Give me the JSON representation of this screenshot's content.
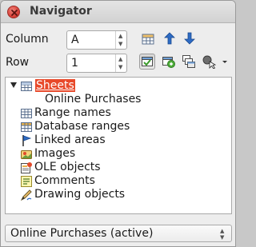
{
  "window": {
    "title": "Navigator"
  },
  "fields": {
    "column_label": "Column",
    "column_value": "A",
    "row_label": "Row",
    "row_value": "1"
  },
  "toolbar": {
    "icons": [
      "data-range-icon",
      "previous-arrow-icon",
      "next-arrow-icon",
      "contents-toggle-icon",
      "toggle-icon",
      "scenarios-icon",
      "drag-mode-icon"
    ],
    "contents_pressed": true
  },
  "tree": {
    "items": [
      {
        "label": "Sheets",
        "icon": "sheet-grid-icon",
        "expanded": true,
        "selected": true,
        "children": [
          "Online Purchases"
        ]
      },
      {
        "label": "Range names",
        "icon": "range-names-icon"
      },
      {
        "label": "Database ranges",
        "icon": "database-icon"
      },
      {
        "label": "Linked areas",
        "icon": "link-flag-icon"
      },
      {
        "label": "Images",
        "icon": "image-icon"
      },
      {
        "label": "OLE objects",
        "icon": "ole-object-icon"
      },
      {
        "label": "Comments",
        "icon": "comment-icon"
      },
      {
        "label": "Drawing objects",
        "icon": "drawing-icon"
      }
    ]
  },
  "document_select": {
    "value": "Online Purchases (active)"
  },
  "colors": {
    "selection": "#e8492a",
    "close_button": "#d9433a",
    "arrow_blue": "#2d6bc4"
  }
}
